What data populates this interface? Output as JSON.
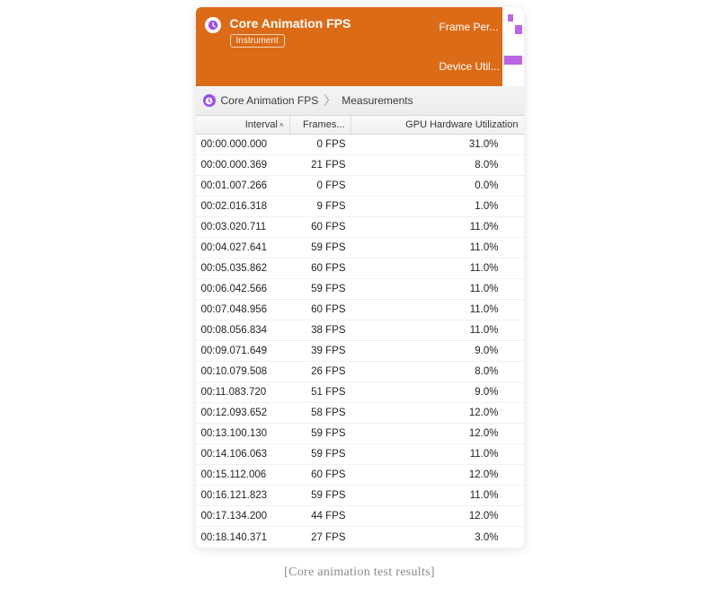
{
  "header": {
    "title": "Core Animation FPS",
    "tag": "Instrument",
    "tracks": [
      {
        "label": "Frame Per..."
      },
      {
        "label": "Device Util..."
      }
    ]
  },
  "breadcrumb": {
    "primary": "Core Animation FPS",
    "secondary": "Measurements"
  },
  "columns": {
    "interval": "Interval",
    "frames": "Frames...",
    "gpu": "GPU Hardware Utilization"
  },
  "sort": {
    "column": "interval",
    "dir": "asc"
  },
  "rows": [
    {
      "interval": "00:00.000.000",
      "frames": "0 FPS",
      "gpu": "31.0%"
    },
    {
      "interval": "00:00.000.369",
      "frames": "21 FPS",
      "gpu": "8.0%"
    },
    {
      "interval": "00:01.007.266",
      "frames": "0 FPS",
      "gpu": "0.0%"
    },
    {
      "interval": "00:02.016.318",
      "frames": "9 FPS",
      "gpu": "1.0%"
    },
    {
      "interval": "00:03.020.711",
      "frames": "60 FPS",
      "gpu": "11.0%"
    },
    {
      "interval": "00:04.027.641",
      "frames": "59 FPS",
      "gpu": "11.0%"
    },
    {
      "interval": "00:05.035.862",
      "frames": "60 FPS",
      "gpu": "11.0%"
    },
    {
      "interval": "00:06.042.566",
      "frames": "59 FPS",
      "gpu": "11.0%"
    },
    {
      "interval": "00:07.048.956",
      "frames": "60 FPS",
      "gpu": "11.0%"
    },
    {
      "interval": "00:08.056.834",
      "frames": "38 FPS",
      "gpu": "11.0%"
    },
    {
      "interval": "00:09.071.649",
      "frames": "39 FPS",
      "gpu": "9.0%"
    },
    {
      "interval": "00:10.079.508",
      "frames": "26 FPS",
      "gpu": "8.0%"
    },
    {
      "interval": "00:11.083.720",
      "frames": "51 FPS",
      "gpu": "9.0%"
    },
    {
      "interval": "00:12.093.652",
      "frames": "58 FPS",
      "gpu": "12.0%"
    },
    {
      "interval": "00:13.100.130",
      "frames": "59 FPS",
      "gpu": "12.0%"
    },
    {
      "interval": "00:14.106.063",
      "frames": "59 FPS",
      "gpu": "11.0%"
    },
    {
      "interval": "00:15.112.006",
      "frames": "60 FPS",
      "gpu": "12.0%"
    },
    {
      "interval": "00:16.121.823",
      "frames": "59 FPS",
      "gpu": "11.0%"
    },
    {
      "interval": "00:17.134.200",
      "frames": "44 FPS",
      "gpu": "12.0%"
    },
    {
      "interval": "00:18.140.371",
      "frames": "27 FPS",
      "gpu": "3.0%"
    }
  ],
  "caption": "[Core animation test results]",
  "colors": {
    "accent": "#DC6B17",
    "purple": "#9B4EE6",
    "trackBar": "#BB66E2"
  }
}
